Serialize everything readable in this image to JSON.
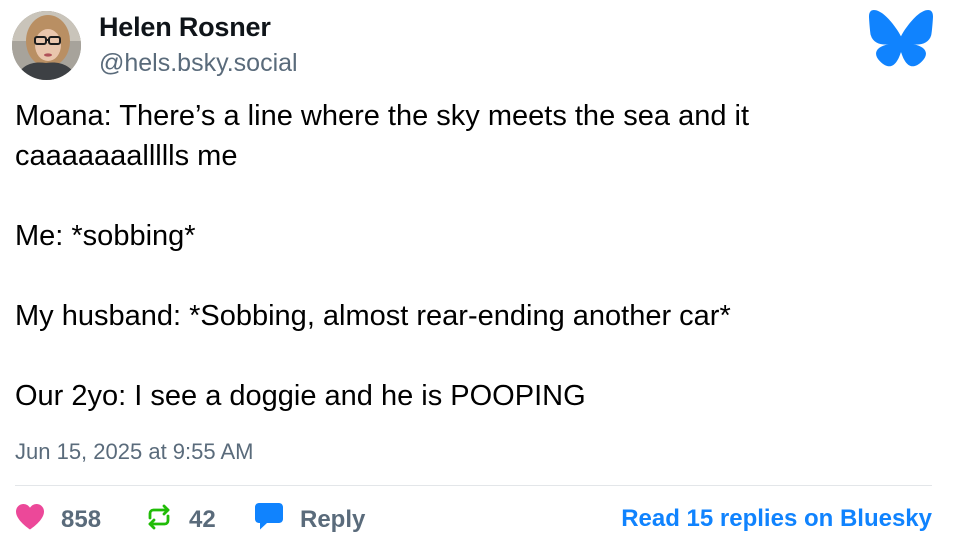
{
  "author": {
    "name": "Helen Rosner",
    "handle": "@hels.bsky.social"
  },
  "brand": {
    "logo_icon": "bluesky-butterfly-icon",
    "accent_color": "#1083fe"
  },
  "post": {
    "lines": [
      "Moana: There’s a line where the sky meets the sea and it",
      "caaaaaaallllls me",
      "Me: *sobbing*",
      "My husband: *Sobbing, almost rear-ending another car*",
      "Our 2yo: I see a doggie and he is POOPING"
    ],
    "timestamp": "Jun 15, 2025 at 9:55 AM"
  },
  "actions": {
    "likes": {
      "icon": "heart-icon",
      "count": "858",
      "color": "#ec4899"
    },
    "reposts": {
      "icon": "repost-icon",
      "count": "42",
      "color": "#20bc07"
    },
    "reply": {
      "icon": "speech-bubble-icon",
      "label": "Reply",
      "color": "#1083fe"
    },
    "read_replies": "Read 15 replies on Bluesky"
  }
}
